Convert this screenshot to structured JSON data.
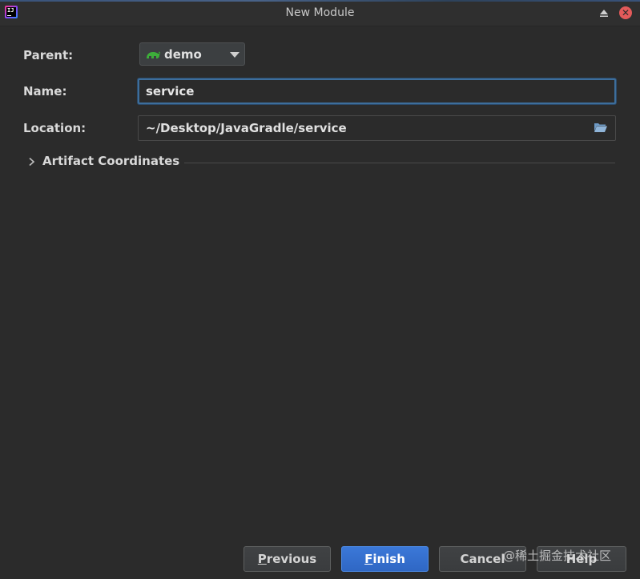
{
  "window": {
    "title": "New Module",
    "app_icon": "intellij-idea-icon",
    "controls": [
      "minimize-icon",
      "close-icon"
    ]
  },
  "form": {
    "parent_label": "Parent:",
    "parent_value": "demo",
    "parent_icon": "gradle-icon",
    "name_label": "Name:",
    "name_value": "service",
    "location_label": "Location:",
    "location_value": "~/Desktop/JavaGradle/service",
    "location_icon": "folder-open-icon"
  },
  "sections": {
    "artifact_coordinates": "Artifact Coordinates",
    "expanded": false
  },
  "buttons": {
    "previous": {
      "mnemonic": "P",
      "rest": "revious"
    },
    "finish": {
      "mnemonic": "F",
      "rest": "inish"
    },
    "cancel": "Cancel",
    "help": "Help"
  },
  "watermark": "@稀土掘金技术社区",
  "colors": {
    "background": "#2b2b2b",
    "accent": "#3b78d8",
    "focus_border": "#3d6e9c",
    "gradle_green": "#3dae3a",
    "close_red": "#e35a5a"
  }
}
